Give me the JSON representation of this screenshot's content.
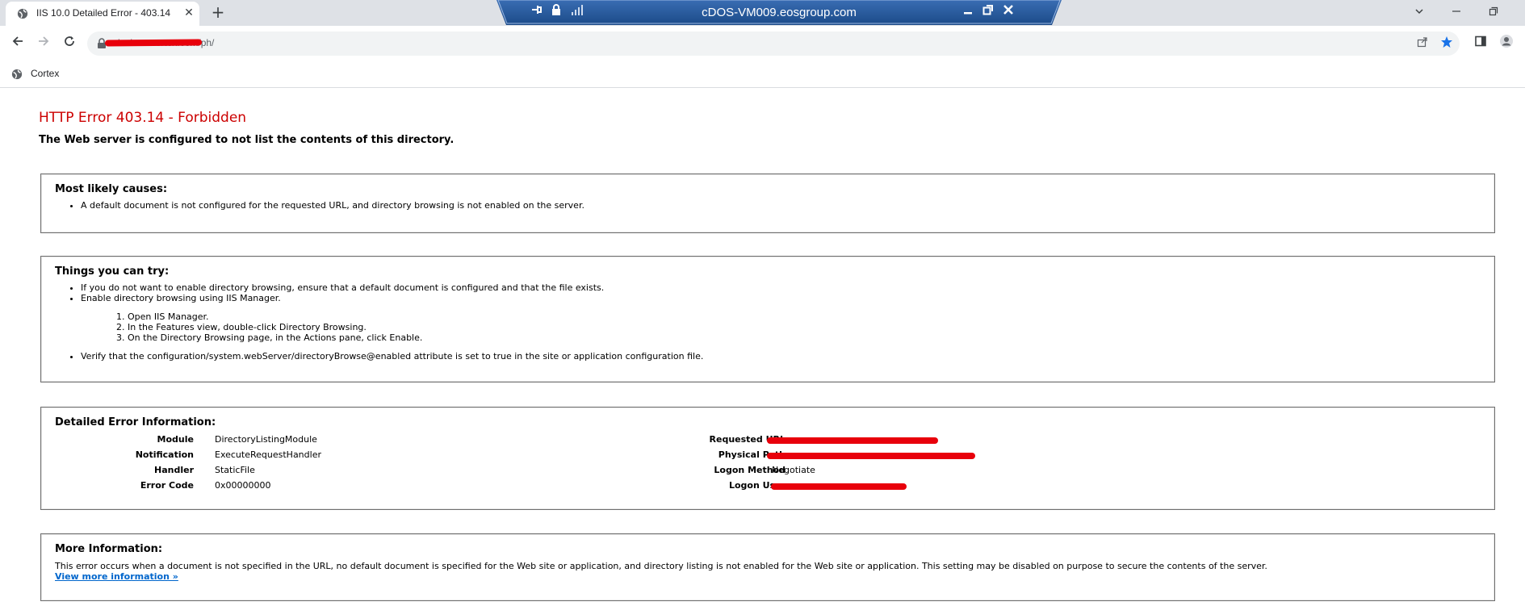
{
  "browser": {
    "tab": {
      "title": "IIS 10.0 Detailed Error - 403.14 -"
    },
    "url_visible": "dosi.eoscortex.com/ph/",
    "bookmarks": [
      {
        "label": "Cortex"
      }
    ]
  },
  "remote_session": {
    "title": "cDOS-VM009.eosgroup.com"
  },
  "page": {
    "title": "HTTP Error 403.14 - Forbidden",
    "subtitle": "The Web server is configured to not list the contents of this directory.",
    "causes": {
      "heading": "Most likely causes:",
      "items": [
        "A default document is not configured for the requested URL, and directory browsing is not enabled on the server."
      ]
    },
    "try": {
      "heading": "Things you can try:",
      "items": [
        "If you do not want to enable directory browsing, ensure that a default document is configured and that the file exists.",
        "Enable directory browsing using IIS Manager."
      ],
      "steps": [
        "Open IIS Manager.",
        "In the Features view, double-click Directory Browsing.",
        "On the Directory Browsing page, in the Actions pane, click Enable."
      ],
      "last_item": "Verify that the configuration/system.webServer/directoryBrowse@enabled attribute is set to true in the site or application configuration file."
    },
    "details": {
      "heading": "Detailed Error Information:",
      "left": [
        {
          "label": "Module",
          "value": "DirectoryListingModule"
        },
        {
          "label": "Notification",
          "value": "ExecuteRequestHandler"
        },
        {
          "label": "Handler",
          "value": "StaticFile"
        },
        {
          "label": "Error Code",
          "value": "0x00000000"
        }
      ],
      "right": [
        {
          "label": "Requested URL",
          "value": ""
        },
        {
          "label": "Physical Path",
          "value": ""
        },
        {
          "label": "Logon Method",
          "value": "Negotiate"
        },
        {
          "label": "Logon User",
          "value": ""
        }
      ]
    },
    "more": {
      "heading": "More Information:",
      "text": "This error occurs when a document is not specified in the URL, no default document is specified for the Web site or application, and directory listing is not enabled for the Web site or application. This setting may be disabled on purpose to secure the contents of the server.",
      "link": "View more information »"
    }
  },
  "colors": {
    "error_red": "#cc0000",
    "rdp_blue": "#1f4f8c",
    "link_blue": "#0066cc",
    "redaction": "#e8000b"
  }
}
